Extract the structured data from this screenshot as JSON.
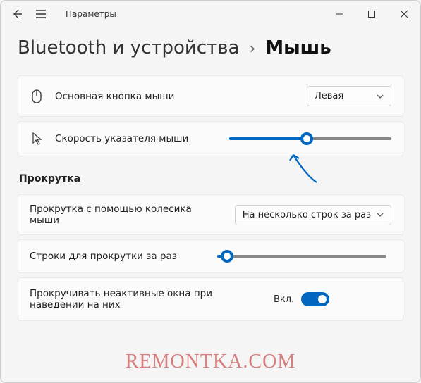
{
  "titlebar": {
    "app_title": "Параметры"
  },
  "breadcrumb": {
    "parent": "Bluetooth и устройства",
    "sep": "›",
    "current": "Мышь"
  },
  "primary_button": {
    "label": "Основная кнопка мыши",
    "selected": "Левая"
  },
  "pointer_speed": {
    "label": "Скорость указателя мыши",
    "percent": 48
  },
  "section_scroll": "Прокрутка",
  "wheel_scroll": {
    "label": "Прокрутка с помощью колесика мыши",
    "selected": "На несколько строк за раз"
  },
  "lines_scroll": {
    "label": "Строки для прокрутки за раз",
    "percent": 6
  },
  "inactive_scroll": {
    "label": "Прокручивать неактивные окна при наведении на них",
    "state_label": "Вкл.",
    "on": true
  },
  "watermark": "REMONTKA.COM"
}
